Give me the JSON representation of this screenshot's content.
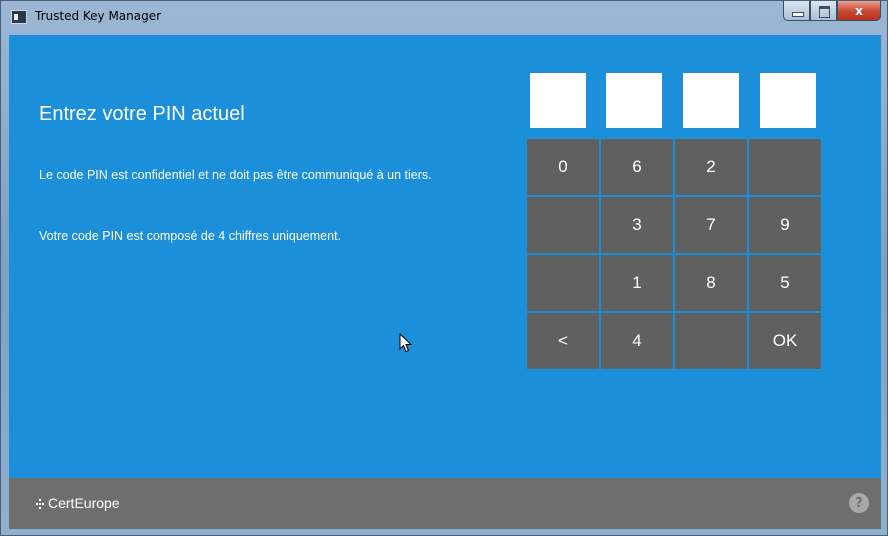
{
  "window": {
    "title": "Trusted Key Manager",
    "close_glyph": "x"
  },
  "main": {
    "heading": "Entrez votre PIN actuel",
    "description": "Le code PIN est confidentiel et ne doit pas être communiqué à un tiers.",
    "pin_info": "Votre code PIN est composé de 4 chiffres uniquement.",
    "pin_length": 4
  },
  "keypad": {
    "keys": [
      "0",
      "6",
      "2",
      "",
      "",
      "3",
      "7",
      "9",
      "",
      "1",
      "8",
      "5",
      "<",
      "4",
      "",
      "OK"
    ]
  },
  "footer": {
    "logo_text": "CertEurope",
    "help_glyph": "?"
  },
  "colors": {
    "background": "#1b8fd9",
    "key": "#606060",
    "footer": "#6e6e6e"
  }
}
